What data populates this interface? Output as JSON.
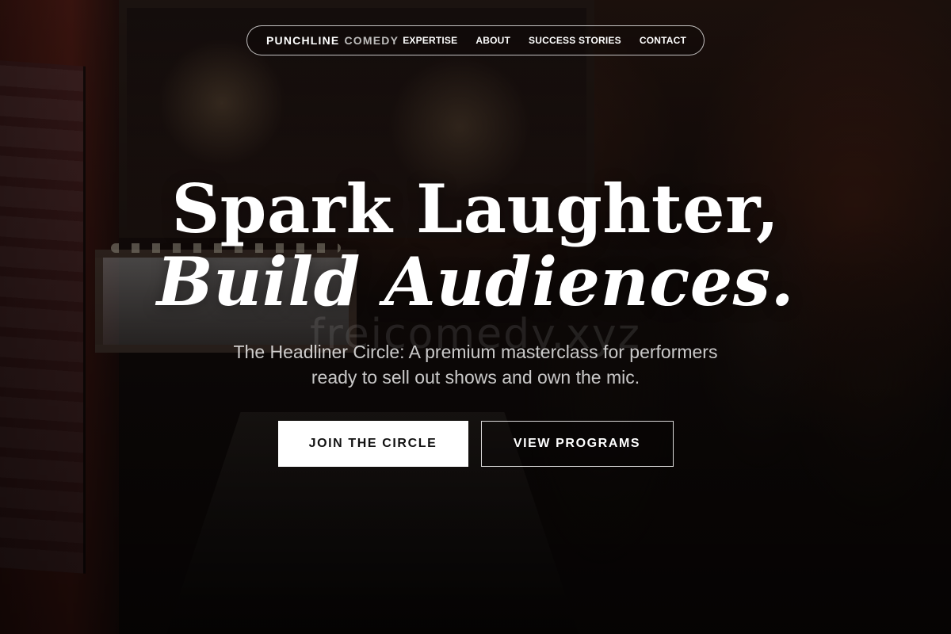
{
  "brand": {
    "part1": "PUNCHLINE",
    "part2": "COMEDY"
  },
  "nav": {
    "links": [
      {
        "label": "EXPERTISE"
      },
      {
        "label": "ABOUT"
      },
      {
        "label": "SUCCESS STORIES"
      },
      {
        "label": "CONTACT"
      }
    ]
  },
  "hero": {
    "headline_line1": "Spark Laughter,",
    "headline_line2": "Build Audiences.",
    "subhead_line1": "The Headliner Circle: A premium masterclass for performers",
    "subhead_line2": "ready to sell out shows and own the mic.",
    "watermark": "freicomedy.xyz"
  },
  "cta": {
    "primary_label": "JOIN THE CIRCLE",
    "secondary_label": "VIEW PROGRAMS"
  }
}
